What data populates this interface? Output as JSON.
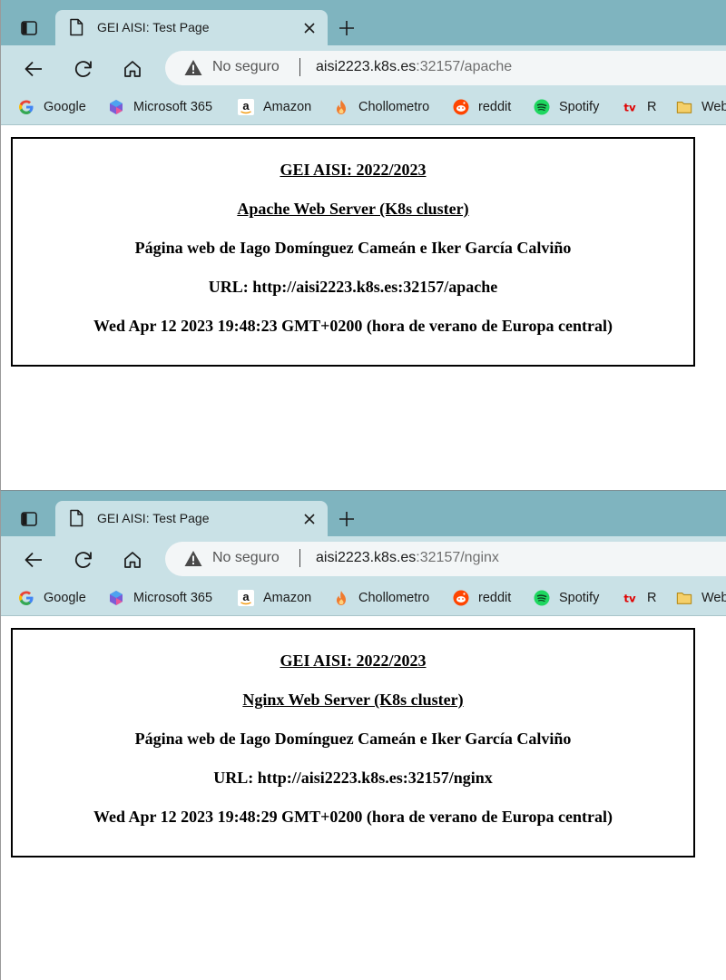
{
  "windows": [
    {
      "tab": {
        "title": "GEI AISI: Test Page"
      },
      "address_bar": {
        "security_text": "No seguro",
        "url_host": "aisi2223.k8s.es",
        "url_rest": ":32157/apache"
      },
      "bookmarks": [
        "Google",
        "Microsoft 365",
        "Amazon",
        "Chollometro",
        "reddit",
        "Spotify",
        "R",
        "Web"
      ],
      "page": {
        "course": "GEI AISI: 2022/2023",
        "server": "Apache Web Server (K8s cluster)",
        "authors": "Página web de Iago Domínguez Cameán e Iker García Calviño",
        "url": "URL: http://aisi2223.k8s.es:32157/apache",
        "date": "Wed Apr 12 2023 19:48:23 GMT+0200 (hora de verano de Europa central)"
      }
    },
    {
      "tab": {
        "title": "GEI AISI: Test Page"
      },
      "address_bar": {
        "security_text": "No seguro",
        "url_host": "aisi2223.k8s.es",
        "url_rest": ":32157/nginx"
      },
      "bookmarks": [
        "Google",
        "Microsoft 365",
        "Amazon",
        "Chollometro",
        "reddit",
        "Spotify",
        "R",
        "Web"
      ],
      "page": {
        "course": "GEI AISI: 2022/2023",
        "server": "Nginx Web Server (K8s cluster)",
        "authors": "Página web de Iago Domínguez Cameán e Iker García Calviño",
        "url": "URL: http://aisi2223.k8s.es:32157/nginx",
        "date": "Wed Apr 12 2023 19:48:29 GMT+0200 (hora de verano de Europa central)"
      }
    }
  ],
  "icons": {
    "tab_actions": "tab-actions-icon",
    "document": "document-icon",
    "close": "close-icon",
    "new_tab": "plus-icon",
    "back": "back-arrow-icon",
    "reload": "reload-icon",
    "home": "home-icon",
    "warning": "warning-icon"
  },
  "colors": {
    "tabstrip": "#7fb4bf",
    "toolbar": "#c9e1e6",
    "omnibox": "#f3f6f7"
  }
}
